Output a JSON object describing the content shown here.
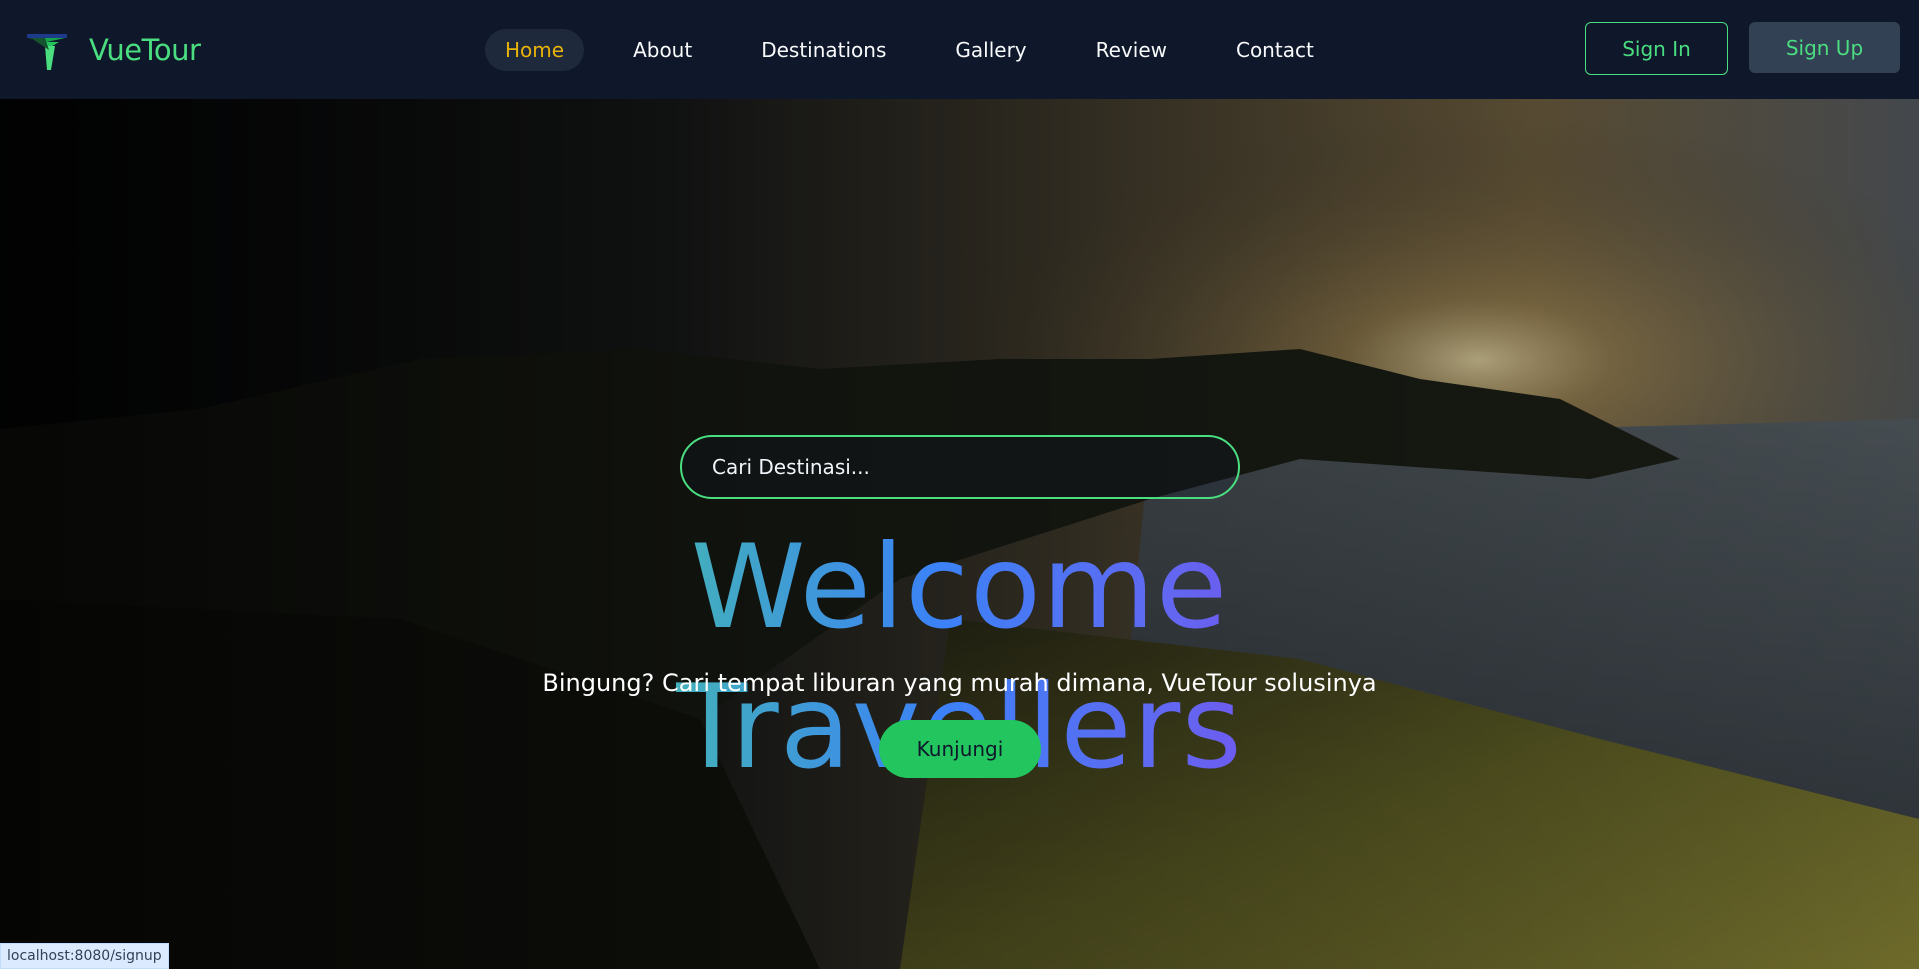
{
  "brand": {
    "name": "VueTour",
    "logo_icon": "vuetour-logo-icon"
  },
  "nav": {
    "items": [
      {
        "label": "Home",
        "active": true
      },
      {
        "label": "About",
        "active": false
      },
      {
        "label": "Destinations",
        "active": false
      },
      {
        "label": "Gallery",
        "active": false
      },
      {
        "label": "Review",
        "active": false
      },
      {
        "label": "Contact",
        "active": false
      }
    ],
    "signin_label": "Sign In",
    "signup_label": "Sign Up"
  },
  "hero": {
    "search_placeholder": "Cari Destinasi...",
    "title": "Welcome Travellers",
    "subtitle": "Bingung? Cari tempat liburan yang murah dimana, VueTour solusinya",
    "cta_label": "Kunjungi"
  },
  "status": {
    "url": "localhost:8080/signup"
  },
  "colors": {
    "nav_bg": "#0f172a",
    "accent_green": "#4ade80",
    "active_link": "#eab308",
    "cta_green": "#22c55e",
    "gradient_start": "#4ade80",
    "gradient_mid": "#3b82f6",
    "gradient_end": "#9333ea"
  }
}
